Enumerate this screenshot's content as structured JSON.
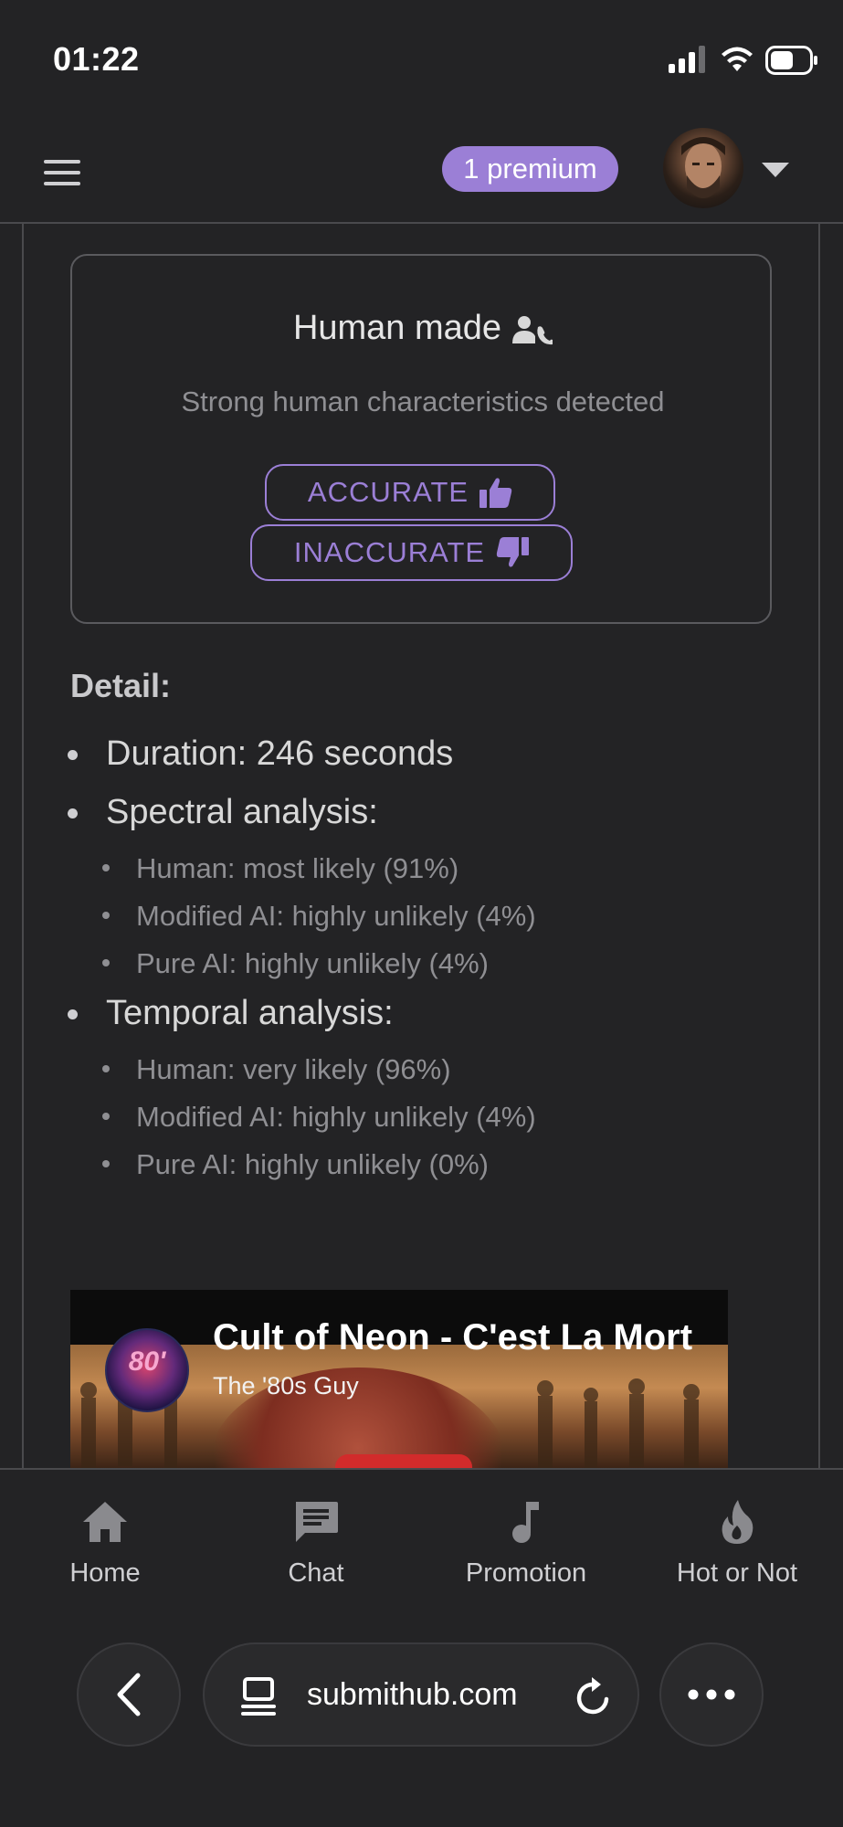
{
  "status_bar": {
    "time": "01:22"
  },
  "header": {
    "premium_badge": "1 premium"
  },
  "result": {
    "title": "Human made",
    "subtitle": "Strong human characteristics detected",
    "accurate_label": "ACCURATE",
    "inaccurate_label": "INACCURATE"
  },
  "detail": {
    "heading": "Detail:",
    "duration": "Duration: 246 seconds",
    "spectral": {
      "label": "Spectral analysis:",
      "items": [
        "Human: most likely (91%)",
        "Modified AI: highly unlikely (4%)",
        "Pure AI: highly unlikely (4%)"
      ]
    },
    "temporal": {
      "label": "Temporal analysis:",
      "items": [
        "Human: very likely (96%)",
        "Modified AI: highly unlikely (4%)",
        "Pure AI: highly unlikely (0%)"
      ]
    }
  },
  "video": {
    "title": "Cult of Neon - C'est La Mort",
    "channel": "The '80s Guy",
    "logo_text": "80'"
  },
  "bottom_nav": {
    "items": [
      {
        "label": "Home",
        "icon": "home-icon"
      },
      {
        "label": "Chat",
        "icon": "chat-icon"
      },
      {
        "label": "Promotion",
        "icon": "music-note-icon"
      },
      {
        "label": "Hot or Not",
        "icon": "flame-icon"
      }
    ]
  },
  "browser": {
    "url": "submithub.com"
  },
  "colors": {
    "accent": "#9b7fd6",
    "background": "#232325"
  }
}
